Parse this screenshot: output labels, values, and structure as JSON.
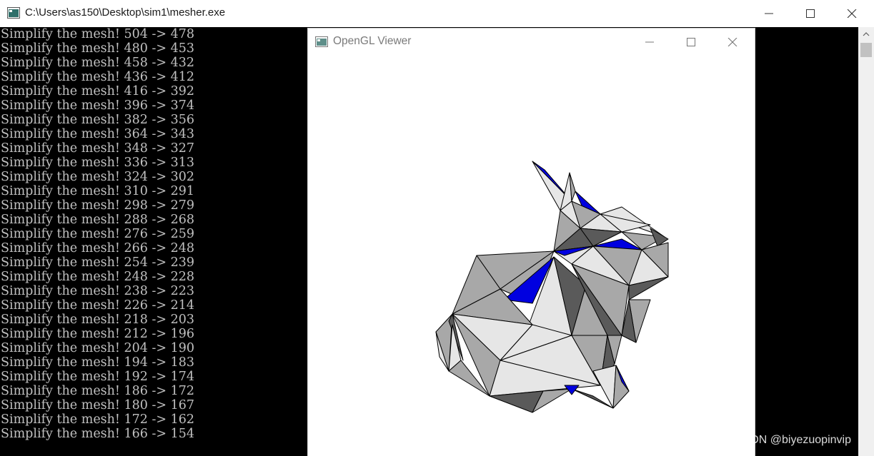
{
  "console": {
    "title": "C:\\Users\\as150\\Desktop\\sim1\\mesher.exe",
    "lines": [
      "Simplify the mesh! 504 -> 478",
      "Simplify the mesh! 480 -> 453",
      "Simplify the mesh! 458 -> 432",
      "Simplify the mesh! 436 -> 412",
      "Simplify the mesh! 416 -> 392",
      "Simplify the mesh! 396 -> 374",
      "Simplify the mesh! 382 -> 356",
      "Simplify the mesh! 364 -> 343",
      "Simplify the mesh! 348 -> 327",
      "Simplify the mesh! 336 -> 313",
      "Simplify the mesh! 324 -> 302",
      "Simplify the mesh! 310 -> 291",
      "Simplify the mesh! 298 -> 279",
      "Simplify the mesh! 288 -> 268",
      "Simplify the mesh! 276 -> 259",
      "Simplify the mesh! 266 -> 248",
      "Simplify the mesh! 254 -> 239",
      "Simplify the mesh! 248 -> 228",
      "Simplify the mesh! 238 -> 223",
      "Simplify the mesh! 226 -> 214",
      "Simplify the mesh! 218 -> 203",
      "Simplify the mesh! 212 -> 196",
      "Simplify the mesh! 204 -> 190",
      "Simplify the mesh! 194 -> 183",
      "Simplify the mesh! 192 -> 174",
      "Simplify the mesh! 186 -> 172",
      "Simplify the mesh! 180 -> 167",
      "Simplify the mesh! 172 -> 162",
      "Simplify the mesh! 166 -> 154"
    ]
  },
  "viewer": {
    "title": "OpenGL Viewer",
    "mesh_colors": {
      "light": "#e6e6e6",
      "mid": "#a8a8a8",
      "dark": "#5a5a5a",
      "back_face": "#0000e0",
      "edge": "#000000"
    }
  },
  "watermark": "CSDN @biyezuopinvip",
  "icons": {
    "minimize": "minimize-icon",
    "maximize": "maximize-icon",
    "close": "close-icon",
    "app": "console-app-icon"
  }
}
